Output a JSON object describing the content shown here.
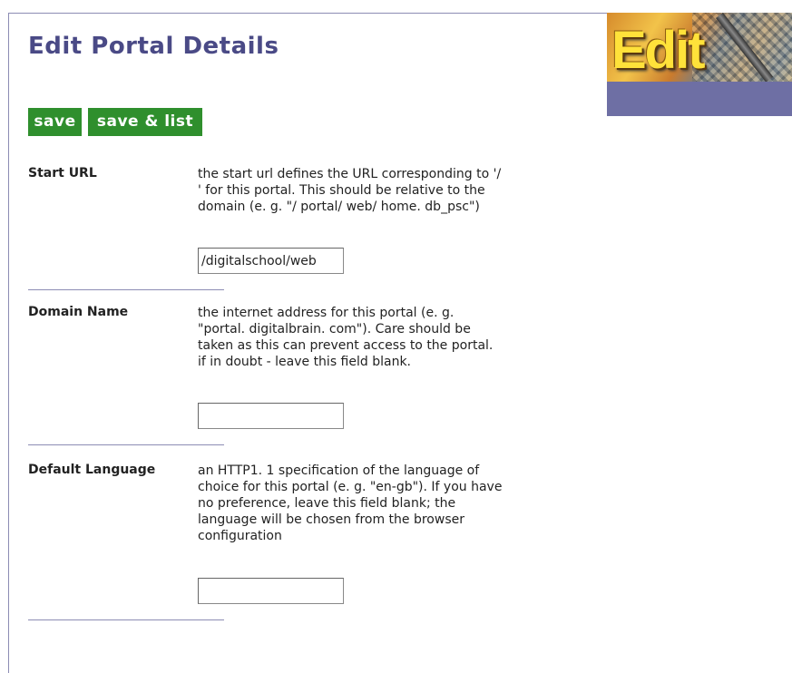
{
  "page": {
    "title": "Edit Portal Details"
  },
  "logo": {
    "word": "Edit"
  },
  "toolbar": {
    "save_label": "save",
    "save_list_label": "save & list"
  },
  "fields": [
    {
      "label": "Start URL",
      "description_lines": [
        "the start url defines the URL corresponding to '/",
        "' for this portal. This should be relative to the",
        "domain (e. g. \"/ portal/ web/ home. db_psc\")"
      ],
      "value": "/digitalschool/web"
    },
    {
      "label": "Domain Name",
      "description_lines": [
        "the internet address for this portal (e. g.",
        "\"portal. digitalbrain. com\"). Care should be",
        "taken as this can prevent access to the portal.",
        "if in doubt - leave this field blank."
      ],
      "value": ""
    },
    {
      "label": "Default Language",
      "description_lines": [
        "an HTTP1. 1 specification of the language of",
        "choice for this portal (e. g. \"en-gb\"). If you have",
        "no preference, leave this field blank; the",
        "language will be chosen from the browser",
        "configuration"
      ],
      "value": ""
    }
  ],
  "colors": {
    "title": "#4a4a86",
    "button": "#2f8f2d",
    "rule": "#8c8cb4",
    "logo_band": "#6e6fa4"
  }
}
